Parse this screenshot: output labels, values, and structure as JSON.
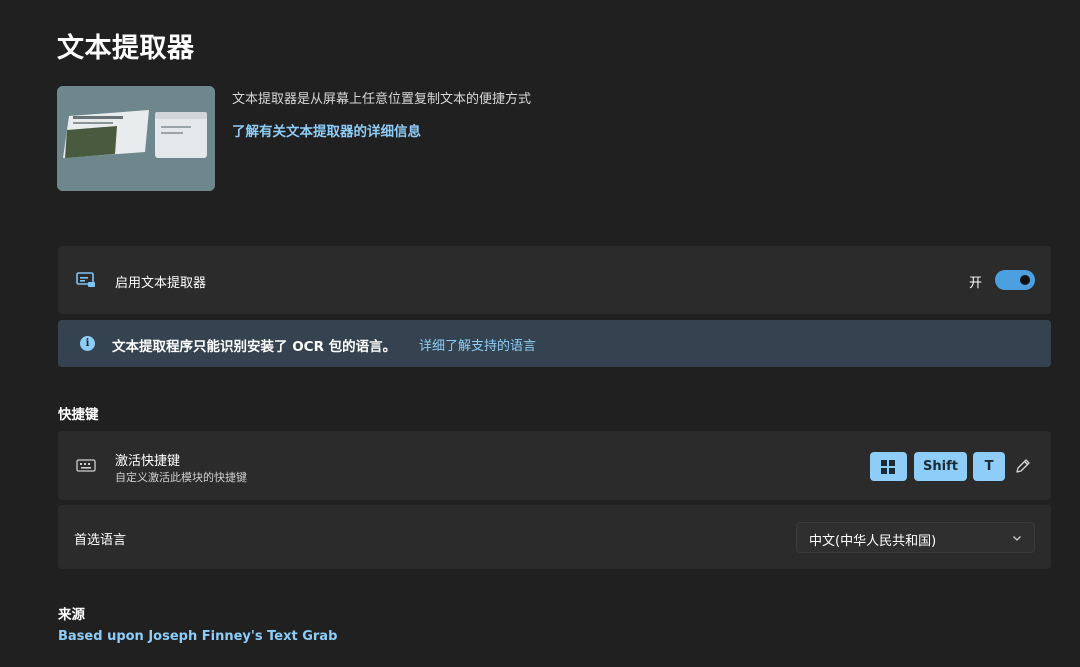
{
  "page": {
    "title": "文本提取器"
  },
  "hero": {
    "description": "文本提取器是从屏幕上任意位置复制文本的便捷方式",
    "link": "了解有关文本提取器的详细信息"
  },
  "enable": {
    "label": "启用文本提取器",
    "state": "开",
    "on": true
  },
  "info": {
    "text": "文本提取程序只能识别安装了 OCR 包的语言。",
    "link": "详细了解支持的语言"
  },
  "shortcuts": {
    "section_title": "快捷键",
    "activation": {
      "label": "激活快捷键",
      "sublabel": "自定义激活此模块的快捷键",
      "keys": [
        "win",
        "Shift",
        "T"
      ]
    }
  },
  "language": {
    "label": "首选语言",
    "value": "中文(中华人民共和国)"
  },
  "source": {
    "section_title": "来源",
    "link": "Based upon Joseph Finney's Text Grab"
  },
  "colors": {
    "accent": "#8ecdf8",
    "toggle": "#4ca0e0",
    "background": "#202020",
    "card": "#2b2b2b",
    "infobar": "#34434f"
  }
}
